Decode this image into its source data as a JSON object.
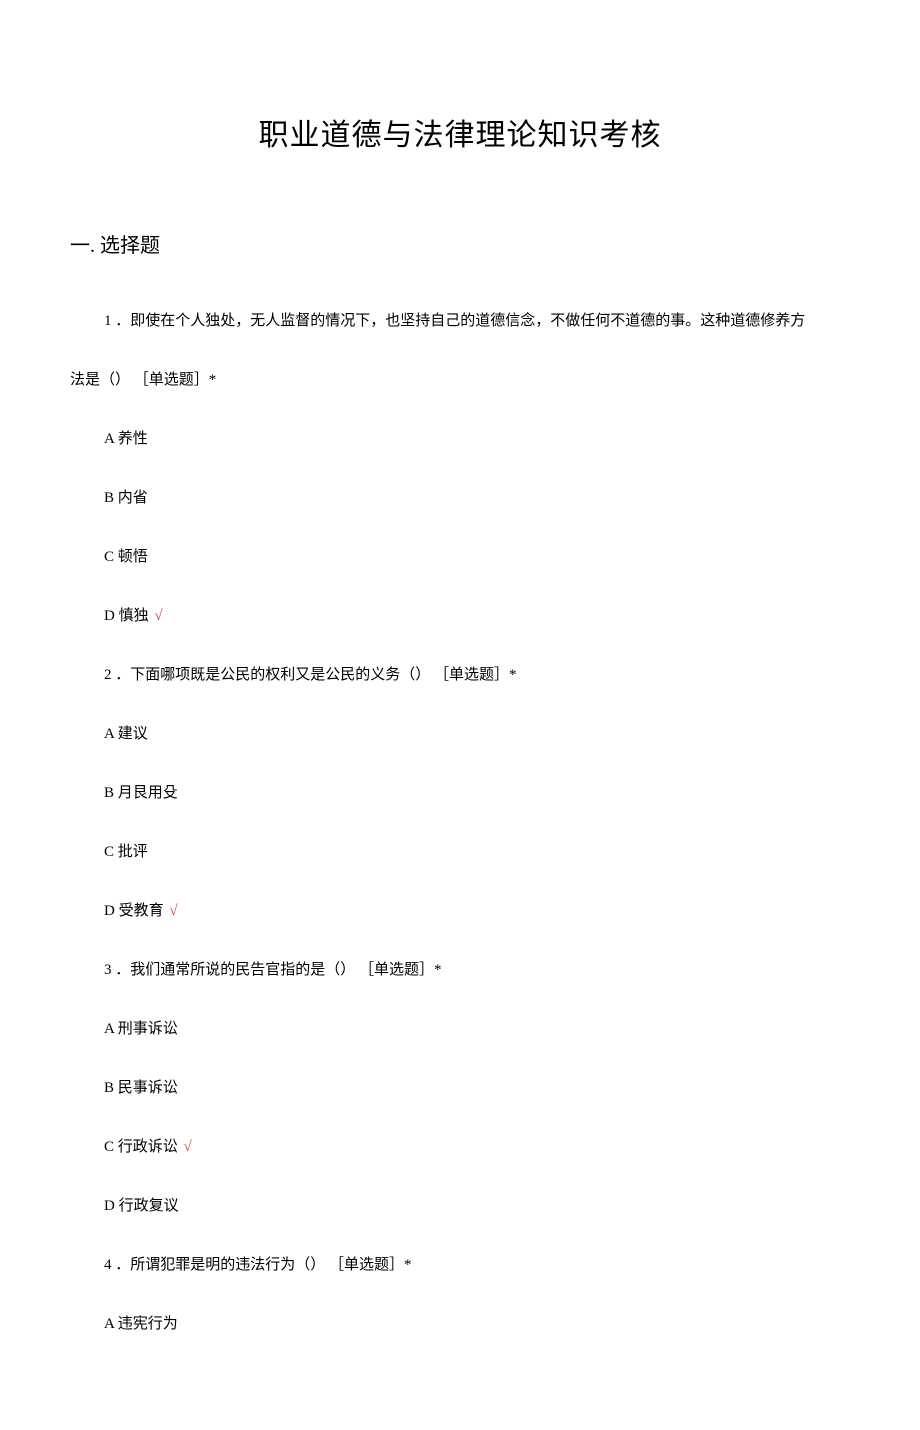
{
  "title": "职业道德与法律理论知识考核",
  "section_header": "一. 选择题",
  "q1": {
    "text_line1": "1 ．即使在个人独处，无人监督的情况下，也坚持自己的道德信念，不做任何不道德的事。这种道德修养方",
    "text_line2": "法是（） ［单选题］*",
    "a": "A 养性",
    "b": "B 内省",
    "c": "C 顿悟",
    "d": "D 慎独",
    "check": "√"
  },
  "q2": {
    "text": "2 ．下面哪项既是公民的权利又是公民的义务（） ［单选题］*",
    "a": "A 建议",
    "b": "B 月艮用殳",
    "c": "C 批评",
    "d": "D 受教育",
    "check": "√"
  },
  "q3": {
    "text": "3 ．我们通常所说的民告官指的是（） ［单选题］*",
    "a": "A 刑事诉讼",
    "b": "B 民事诉讼",
    "c": "C 行政诉讼",
    "check": "√",
    "d": "D 行政复议"
  },
  "q4": {
    "text": "4 ．所谓犯罪是明的违法行为（） ［单选题］*",
    "a": "A 违宪行为"
  }
}
